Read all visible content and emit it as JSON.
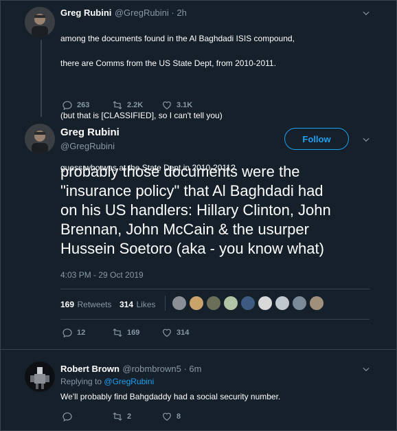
{
  "tweet1": {
    "name": "Greg Rubini",
    "meta": "@GregRubini · 2h",
    "lines": [
      "among the documents found in the Al Baghdadi ISIS compound,",
      "there are Comms from the US State Dept, from 2010-2011.",
      "",
      "(but that is [CLASSIFIED], so I can't tell you)",
      "",
      "guess who was at the State Dept in 2010-2011?"
    ],
    "replies": "263",
    "retweets": "2.2K",
    "likes": "3.1K"
  },
  "tweet2": {
    "name": "Greg Rubini",
    "handle": "@GregRubini",
    "follow_label": "Follow",
    "text_lines": [
      "probably those documents were the",
      "\"insurance policy\" that Al Baghdadi had",
      "on his US handlers: Hillary Clinton, John",
      "Brennan, John McCain & the usurper",
      "Hussein Soetoro (aka - you know what)"
    ],
    "timestamp": "4:03 PM - 29 Oct 2019",
    "retweet_count": "169",
    "retweet_label": "Retweets",
    "like_count": "314",
    "like_label": "Likes",
    "liker_avatar_colors": [
      "#8a8f95",
      "#c9a36a",
      "#6b6f5a",
      "#b0c4a8",
      "#3d5a80",
      "#d9d9d9",
      "#c0c7cf",
      "#7a8a99",
      "#a08f7a"
    ],
    "replies": "12",
    "retweets": "169",
    "likes": "314"
  },
  "tweet3": {
    "name": "Robert Brown",
    "meta": "@robmbrown5 · 6m",
    "replying_prefix": "Replying to",
    "replying_to": "@GregRubini",
    "text": "We'll probably find Bahgdaddy had a social security number.",
    "replies": "",
    "retweets": "2",
    "likes": "8"
  },
  "colors": {
    "bg": "#15202b",
    "accent": "#1da1f2",
    "muted": "#8899a6",
    "divider": "#38444d"
  }
}
